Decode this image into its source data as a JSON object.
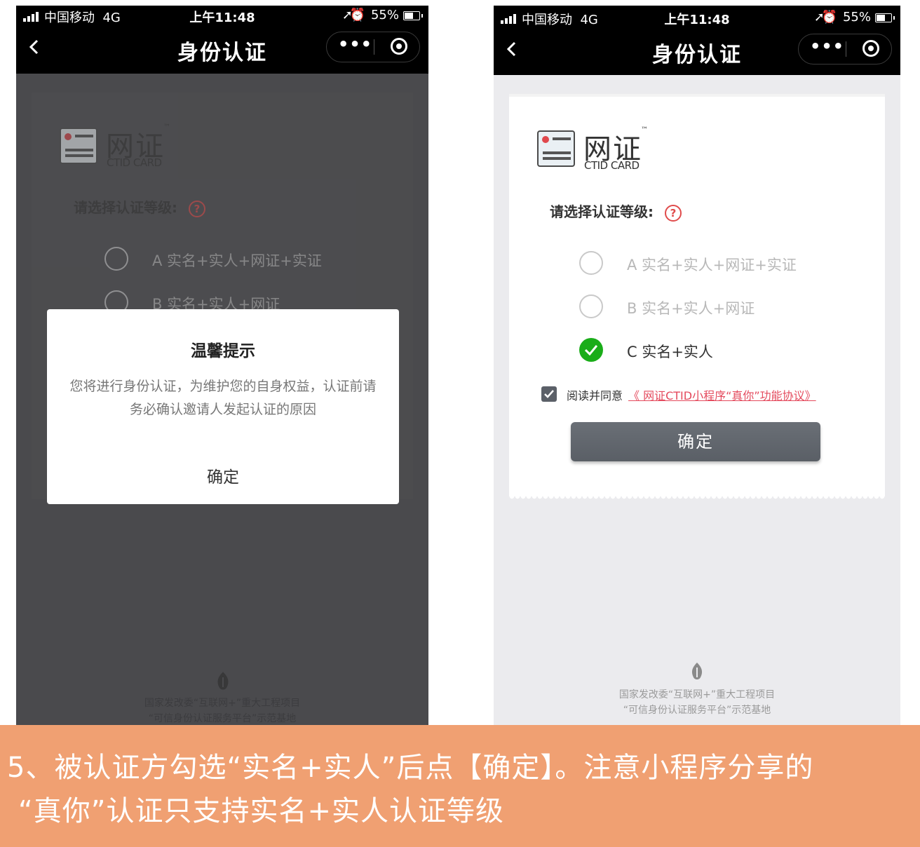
{
  "status_bar": {
    "carrier": "中国移动",
    "network": "4G",
    "time": "上午11:48",
    "battery": "55%"
  },
  "nav": {
    "title": "身份认证",
    "back_icon": "chevron-left-icon",
    "more_icon": "more-dots-icon",
    "close_icon": "target-circle-icon"
  },
  "logo": {
    "name": "网证",
    "tm": "™",
    "subtitle": "CTID CARD"
  },
  "form": {
    "level_label": "请选择认证等级:",
    "help_symbol": "?",
    "options": [
      {
        "label": "A 实名+实人+网证+实证",
        "selected": false
      },
      {
        "label": "B 实名+实人+网证",
        "selected": false
      },
      {
        "label": "C 实名+实人",
        "selected": true
      }
    ],
    "agree_prefix": "阅读并同意",
    "agree_link": "《 网证CTID小程序“真你”功能协议》",
    "agree_checked": true,
    "confirm_label": "确定"
  },
  "footer": {
    "line1": "国家发改委“互联网+”重大工程项目",
    "line2": "“可信身份认证服务平台”示范基地"
  },
  "dialog": {
    "title": "温馨提示",
    "body": "您将进行身份认证，为维护您的自身权益，认证前请务必确认邀请人发起认证的原因",
    "button": "确定"
  },
  "caption": {
    "line1": "5、被认证方勾选“实名+实人”后点【确定】。注意小程序分享的",
    "line2": "“真你”认证只支持实名+实人认证等级"
  },
  "colors": {
    "accent_green": "#1aad19",
    "link_red": "#e44a5d",
    "caption_band": "#f0a072",
    "confirm_button": "#5f646b"
  }
}
